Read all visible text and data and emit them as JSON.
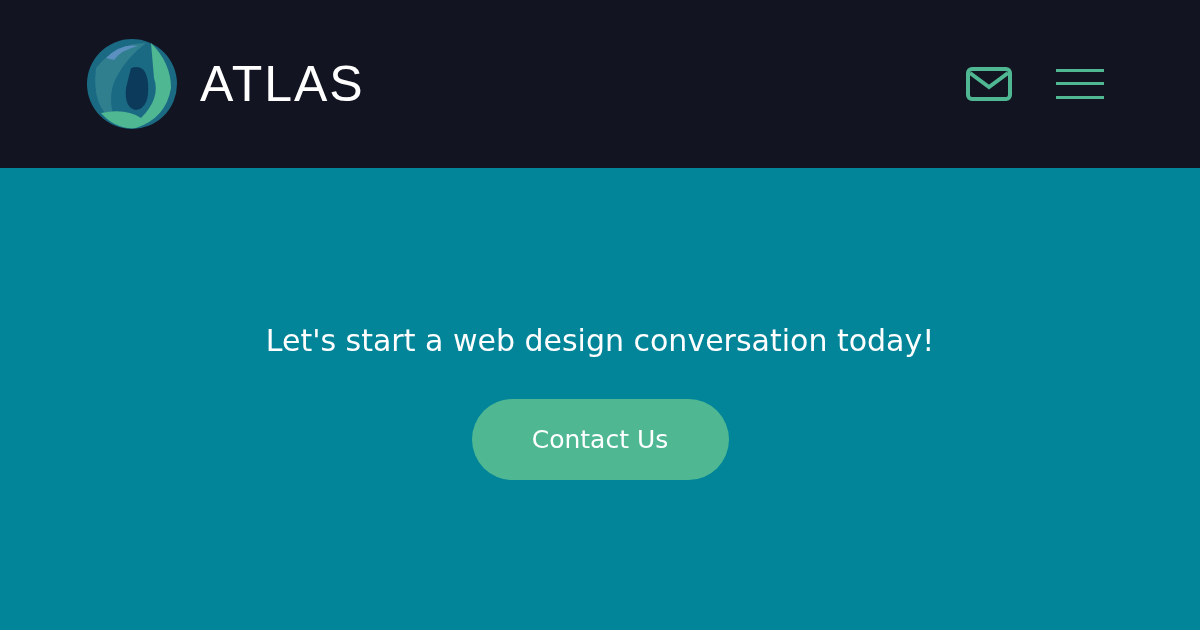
{
  "header": {
    "logo_text": "ATLAS"
  },
  "hero": {
    "message": "Let's start a web design conversation today!",
    "button": "Contact Us"
  }
}
